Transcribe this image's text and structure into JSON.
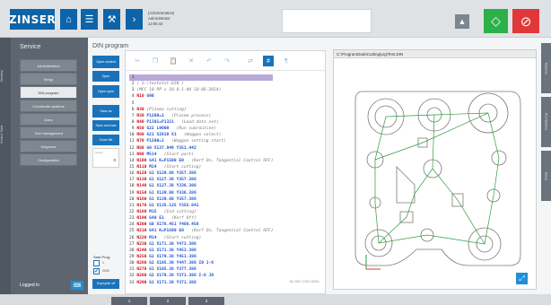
{
  "topbar": {
    "logo": "ZINSER",
    "user_role": "(Administration)",
    "user_name": "Administrator",
    "time": "12:55:43",
    "icons": [
      "home-icon",
      "list-icon",
      "tools-icon",
      "chevron-right-icon"
    ],
    "warning_icon": "warning-icon",
    "start_icon": "start-diamond-icon",
    "stop_icon": "stop-circle-icon",
    "colors": {
      "brand": "#0e64a8",
      "start": "#2cb04a",
      "stop": "#e0383a"
    }
  },
  "sidebar": {
    "strip_tabs": [
      "Desktop",
      "Control Table"
    ],
    "title": "Service",
    "items": [
      {
        "label": "Administration",
        "active": false
      },
      {
        "label": "Setup",
        "active": false
      },
      {
        "label": "DIN program",
        "active": true
      },
      {
        "label": "Coordinate systems",
        "active": false
      },
      {
        "label": "Axes",
        "active": false
      },
      {
        "label": "Tool management",
        "active": false
      },
      {
        "label": "Diagnose",
        "active": false
      },
      {
        "label": "Configuration",
        "active": false
      }
    ],
    "logout": "Logged in",
    "keyboard_icon": "keyboard-icon"
  },
  "din": {
    "title": "DIN program",
    "buttons": {
      "open_content": "Open content",
      "open": "Open",
      "open_cycle": "Open cycle",
      "save_as": "Save as",
      "save_and_load": "Save and load",
      "close_file": "Close file",
      "dry_run": "Dry/cyclic off"
    },
    "field_label": "Option",
    "field_value": "0",
    "start_prog_label": "Start Prog:",
    "checkbox1_label": "1",
    "checkbox2_label": "0000",
    "checkbox2_checked": true
  },
  "editor": {
    "toolbar_icons": [
      "cut-icon",
      "copy-icon",
      "paste-icon",
      "delete-icon",
      "undo-icon",
      "redo-icon",
      "wrap-icon",
      "hash-icon",
      "paragraph-icon"
    ],
    "lines": [
      {
        "n": "1",
        "nb": "",
        "code": "",
        "comment": "",
        "highlight": true
      },
      {
        "n": "2",
        "nb": "",
        "code": "",
        "comment": "( S:\\testetst.DIN )"
      },
      {
        "n": "3",
        "nb": "",
        "code": "",
        "comment": "(MCC 10 PP v 10.0.1-48 10-06-2014)"
      },
      {
        "n": "4",
        "nb": "N10",
        "code": "G90",
        "comment": ""
      },
      {
        "n": "5",
        "nb": "",
        "code": "",
        "comment": ""
      },
      {
        "n": "6",
        "nb": "N30",
        "code": "",
        "comment": "(Plasma cutting)"
      },
      {
        "n": "7",
        "nb": "N30",
        "code": "P1200=1",
        "comment": "(Plasma process)"
      },
      {
        "n": "8",
        "nb": "N40",
        "code": "P1301=P1321",
        "comment": "(Load data set)"
      },
      {
        "n": "9",
        "nb": "N50",
        "code": "G22 L9000",
        "comment": "(Run subroutine)"
      },
      {
        "n": "10",
        "nb": "N60",
        "code": "G21 S2810 X1",
        "comment": "(Waggon select)"
      },
      {
        "n": "11",
        "nb": "N70",
        "code": "P1200=1",
        "comment": "(Waggon setting start)"
      },
      {
        "n": "12",
        "nb": "N80",
        "code": "G0 X137.949 Y351.442",
        "comment": ""
      },
      {
        "n": "13",
        "nb": "N90",
        "code": "M514",
        "comment": "(Start part)"
      },
      {
        "n": "14",
        "nb": "N100",
        "code": "G41 K=P1500 E0",
        "comment": "(Kerf On, Tangential Control OFF)"
      },
      {
        "n": "15",
        "nb": "N110",
        "code": "M14",
        "comment": "(Start cutting)"
      },
      {
        "n": "16",
        "nb": "N120",
        "code": "G1 X139.88 Y357.386",
        "comment": ""
      },
      {
        "n": "17",
        "nb": "N130",
        "code": "G1 X127.38 Y357.386",
        "comment": ""
      },
      {
        "n": "18",
        "nb": "N140",
        "code": "G1 X127.38 Y336.386",
        "comment": ""
      },
      {
        "n": "19",
        "nb": "N150",
        "code": "G1 X139.88 Y336.386",
        "comment": ""
      },
      {
        "n": "20",
        "nb": "N160",
        "code": "G1 X139.88 Y357.386",
        "comment": ""
      },
      {
        "n": "21",
        "nb": "N170",
        "code": "G1 X135.125 Y355.841",
        "comment": ""
      },
      {
        "n": "22",
        "nb": "N180",
        "code": "M15",
        "comment": "(End cutting)"
      },
      {
        "n": "23",
        "nb": "N190",
        "code": "G40 E1",
        "comment": "(Kerf Off)"
      },
      {
        "n": "24",
        "nb": "N200",
        "code": "G0 X178.451 Y488.458",
        "comment": ""
      },
      {
        "n": "25",
        "nb": "N210",
        "code": "G41 K=P1500 E0",
        "comment": "(Kerf On, Tangential Control OFF)"
      },
      {
        "n": "26",
        "nb": "N220",
        "code": "M14",
        "comment": "(Start cutting)"
      },
      {
        "n": "27",
        "nb": "N230",
        "code": "G1 X171.38 Y473.386",
        "comment": ""
      },
      {
        "n": "28",
        "nb": "N240",
        "code": "G1 X171.38 Y453.386",
        "comment": ""
      },
      {
        "n": "29",
        "nb": "N250",
        "code": "G1 X179.38 Y451.386",
        "comment": ""
      },
      {
        "n": "30",
        "nb": "N260",
        "code": "G2 X185.38 Y447.386 I0 J-6",
        "comment": ""
      },
      {
        "n": "31",
        "nb": "N270",
        "code": "G1 X185.38 Y377.386",
        "comment": ""
      },
      {
        "n": "32",
        "nb": "N280",
        "code": "G2 X179.38 Y371.386 I-6 J0",
        "comment": ""
      },
      {
        "n": "33",
        "nb": "N290",
        "code": "G1 X171.38 Y371.386",
        "comment": ""
      }
    ],
    "position": "NL N10: 2.001 10001"
  },
  "drawing": {
    "path": "C:\\ProgramData\\Cutting\\prg\\Test.DIN",
    "fit_icon": "fit-to-screen-icon"
  },
  "right_tabs": [
    "Machine",
    "PLC Buttons",
    "Setup"
  ],
  "bottom_tabs": [
    "1",
    "2",
    "3"
  ]
}
